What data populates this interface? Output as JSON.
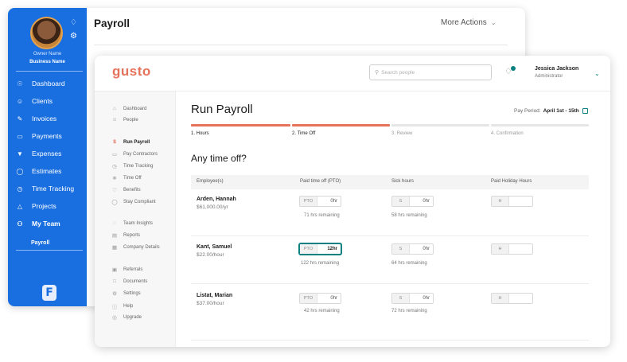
{
  "back": {
    "owner_name": "Owner Name",
    "business_name": "Business Name",
    "nav": [
      {
        "label": "Dashboard",
        "icon": "dashboard-icon"
      },
      {
        "label": "Clients",
        "icon": "clients-icon"
      },
      {
        "label": "Invoices",
        "icon": "invoices-icon"
      },
      {
        "label": "Payments",
        "icon": "payments-icon"
      },
      {
        "label": "Expenses",
        "icon": "expenses-icon"
      },
      {
        "label": "Estimates",
        "icon": "estimates-icon"
      },
      {
        "label": "Time Tracking",
        "icon": "clock-icon"
      },
      {
        "label": "Projects",
        "icon": "projects-icon"
      },
      {
        "label": "My Team",
        "icon": "team-icon"
      }
    ],
    "nav_sub": "Payroll",
    "logo_letter": "F",
    "page_title": "Payroll",
    "more_actions": "More Actions"
  },
  "front": {
    "logo": "gusto",
    "search_placeholder": "Search people",
    "user_name": "Jessica Jackson",
    "user_role": "Administrator",
    "left_nav": [
      {
        "label": "Dashboard",
        "icon": "home-icon"
      },
      {
        "label": "People",
        "icon": "people-icon"
      },
      {
        "label": "Run Payroll",
        "icon": "dollar-icon",
        "active": true
      },
      {
        "label": "Pay Contractors",
        "icon": "contractors-icon"
      },
      {
        "label": "Time Tracking",
        "icon": "clock-icon"
      },
      {
        "label": "Time Off",
        "icon": "time-off-icon"
      },
      {
        "label": "Benefits",
        "icon": "heart-icon"
      },
      {
        "label": "Stay Compliant",
        "icon": "compliance-icon"
      },
      {
        "label": "Team Insights",
        "icon": "insights-icon"
      },
      {
        "label": "Reports",
        "icon": "reports-icon"
      },
      {
        "label": "Company Details",
        "icon": "company-icon"
      },
      {
        "label": "Referrals",
        "icon": "referrals-icon"
      },
      {
        "label": "Documents",
        "icon": "documents-icon"
      },
      {
        "label": "Settings",
        "icon": "settings-icon"
      },
      {
        "label": "Help",
        "icon": "help-icon"
      },
      {
        "label": "Upgrade",
        "icon": "upgrade-icon"
      }
    ],
    "title": "Run Payroll",
    "pay_period_label": "Pay Period:",
    "pay_period_value": "April 1st - 15th",
    "steps": [
      {
        "label": "1. Hours",
        "done": true
      },
      {
        "label": "2. Time Off",
        "done": true
      },
      {
        "label": "3. Review",
        "done": false
      },
      {
        "label": "4. Confirmation",
        "done": false
      }
    ],
    "section_title": "Any time off?",
    "columns": [
      "Employee(s)",
      "Paid time off (PTO)",
      "Sick hours",
      "Paid Holiday Hours"
    ],
    "employees": [
      {
        "name": "Arden, Hannah",
        "rate": "$61,000.00/yr",
        "pto_label": "PTO",
        "pto_value": "0hr",
        "pto_remaining": "71 hrs remaining",
        "sick_label": "S",
        "sick_value": "0hr",
        "sick_remaining": "58 hrs remaining",
        "holiday_label": "H"
      },
      {
        "name": "Kant, Samuel",
        "rate": "$22.00/hour",
        "pto_label": "PTO",
        "pto_value": "12hr",
        "pto_remaining": "122 hrs remaining",
        "sick_label": "S",
        "sick_value": "0hr",
        "sick_remaining": "64 hrs remaining",
        "holiday_label": "H"
      },
      {
        "name": "Listat, Marian",
        "rate": "$37.00/hour",
        "pto_label": "PTO",
        "pto_value": "0hr",
        "pto_remaining": "42 hrs remaining",
        "sick_label": "S",
        "sick_value": "0hr",
        "sick_remaining": "72 hrs remaining",
        "holiday_label": "H"
      }
    ]
  },
  "colors": {
    "brand_blue": "#1a6fe0",
    "gusto_coral": "#e5725b",
    "teal": "#0a8080"
  }
}
